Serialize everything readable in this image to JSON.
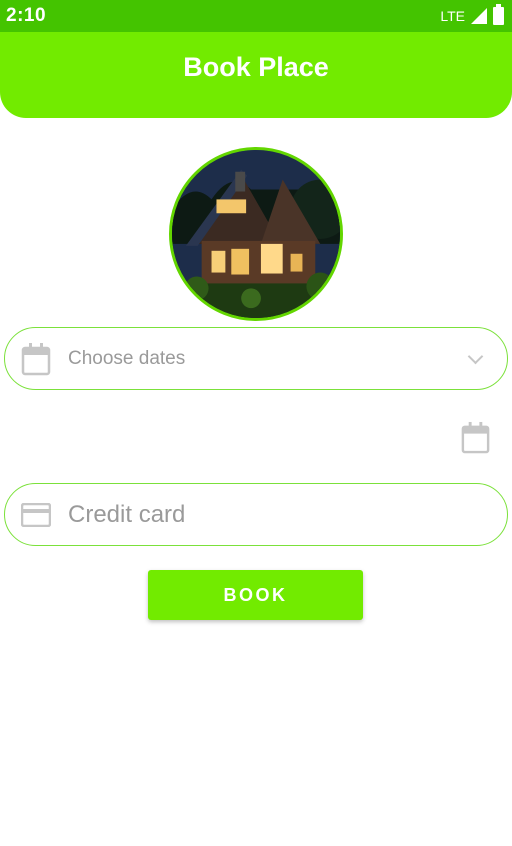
{
  "status_bar": {
    "time": "2:10",
    "network": "LTE"
  },
  "app_bar": {
    "title": "Book Place"
  },
  "property": {
    "image": "house-photo"
  },
  "dates_field": {
    "placeholder": "Choose dates",
    "icon": "calendar-icon",
    "dropdown_icon": "chevron-down-icon"
  },
  "date_picker": {
    "icon": "calendar-icon"
  },
  "card_field": {
    "placeholder": "Credit card",
    "value": "",
    "icon": "credit-card-icon"
  },
  "book_button": {
    "label": "BOOK"
  },
  "colors": {
    "status_bar": "#44c400",
    "accent": "#72eb00",
    "field_border": "#7be13a",
    "hint": "#9a9a9a"
  }
}
